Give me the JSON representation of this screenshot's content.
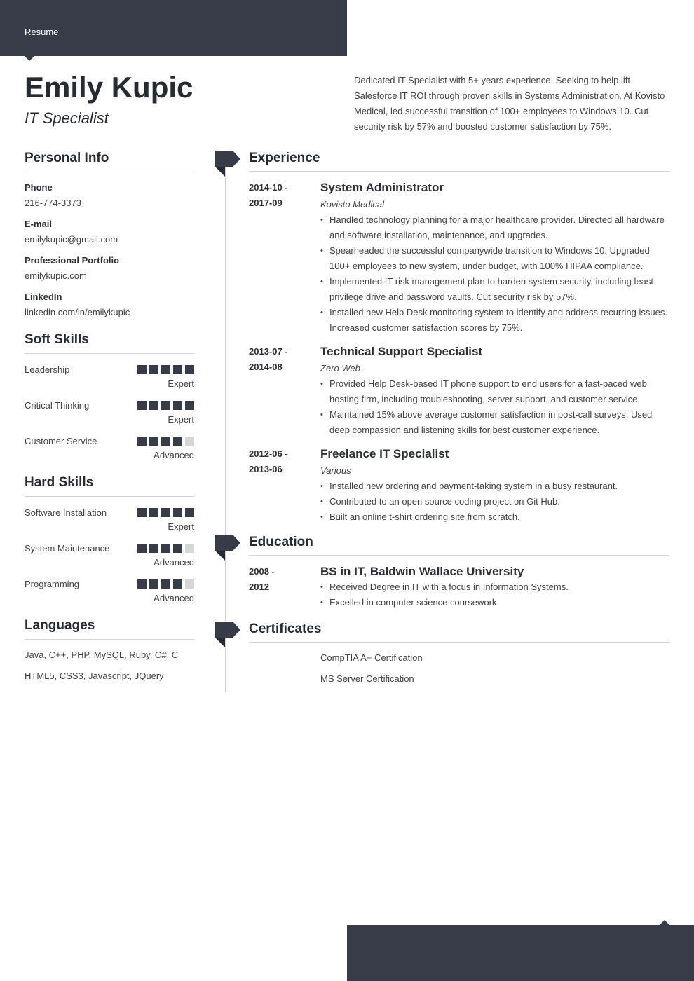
{
  "header": {
    "label": "Resume"
  },
  "name": "Emily Kupic",
  "job_title": "IT Specialist",
  "summary": "Dedicated IT Specialist with 5+ years experience. Seeking to help lift Salesforce IT ROI through proven skills in Systems Administration. At Kovisto Medical, led successful transition of 100+ employees to Windows 10. Cut security risk by 57% and boosted customer satisfaction by 75%.",
  "personal_info": {
    "title": "Personal Info",
    "items": [
      {
        "label": "Phone",
        "value": "216-774-3373"
      },
      {
        "label": "E-mail",
        "value": "emilykupic@gmail.com"
      },
      {
        "label": "Professional Portfolio",
        "value": "emilykupic.com"
      },
      {
        "label": "LinkedIn",
        "value": "linkedin.com/in/emilykupic"
      }
    ]
  },
  "soft_skills": {
    "title": "Soft Skills",
    "items": [
      {
        "name": "Leadership",
        "level": "Expert",
        "rating": 5,
        "max": 5
      },
      {
        "name": "Critical Thinking",
        "level": "Expert",
        "rating": 5,
        "max": 5
      },
      {
        "name": "Customer Service",
        "level": "Advanced",
        "rating": 4,
        "max": 5
      }
    ]
  },
  "hard_skills": {
    "title": "Hard Skills",
    "items": [
      {
        "name": "Software Installation",
        "level": "Expert",
        "rating": 5,
        "max": 5
      },
      {
        "name": "System Maintenance",
        "level": "Advanced",
        "rating": 4,
        "max": 5
      },
      {
        "name": "Programming",
        "level": "Advanced",
        "rating": 4,
        "max": 5
      }
    ]
  },
  "languages": {
    "title": "Languages",
    "items": [
      "Java, C++, PHP, MySQL, Ruby, C#, C",
      "HTML5, CSS3, Javascript, JQuery"
    ]
  },
  "experience": {
    "title": "Experience",
    "items": [
      {
        "date_start": "2014-10 -",
        "date_end": "2017-09",
        "title": "System Administrator",
        "company": "Kovisto Medical",
        "bullets": [
          "Handled technology planning for a major healthcare provider. Directed all hardware and software installation, maintenance, and upgrades.",
          "Spearheaded the successful companywide transition to Windows 10. Upgraded 100+ employees to new system, under budget, with 100% HIPAA compliance.",
          "Implemented IT risk management plan to harden system security, including least privilege drive and password vaults. Cut security risk by 57%.",
          "Installed new Help Desk monitoring system to identify and address recurring issues. Increased customer satisfaction scores by 75%."
        ]
      },
      {
        "date_start": "2013-07 -",
        "date_end": "2014-08",
        "title": "Technical Support Specialist",
        "company": "Zero Web",
        "bullets": [
          "Provided Help Desk-based IT phone support to end users for a fast-paced web hosting firm, including troubleshooting, server support, and customer service.",
          "Maintained 15% above average customer satisfaction in post-call surveys. Used deep compassion and listening skills for best customer experience."
        ]
      },
      {
        "date_start": "2012-06 -",
        "date_end": "2013-06",
        "title": "Freelance IT Specialist",
        "company": "Various",
        "bullets": [
          "Installed new ordering and payment-taking system in a busy restaurant.",
          "Contributed to an open source coding project on Git Hub.",
          "Built an online t-shirt ordering site from scratch."
        ]
      }
    ]
  },
  "education": {
    "title": "Education",
    "items": [
      {
        "date_start": "2008 -",
        "date_end": "2012",
        "title": "BS in IT, Baldwin Wallace University",
        "bullets": [
          "Received Degree in IT with a focus in Information Systems.",
          "Excelled in computer science coursework."
        ]
      }
    ]
  },
  "certificates": {
    "title": "Certificates",
    "items": [
      "CompTIA A+ Certification",
      "MS Server Certification"
    ]
  },
  "colors": {
    "accent": "#373c48",
    "rule": "#d3d3d3",
    "dot_off": "#d6d6d6"
  }
}
